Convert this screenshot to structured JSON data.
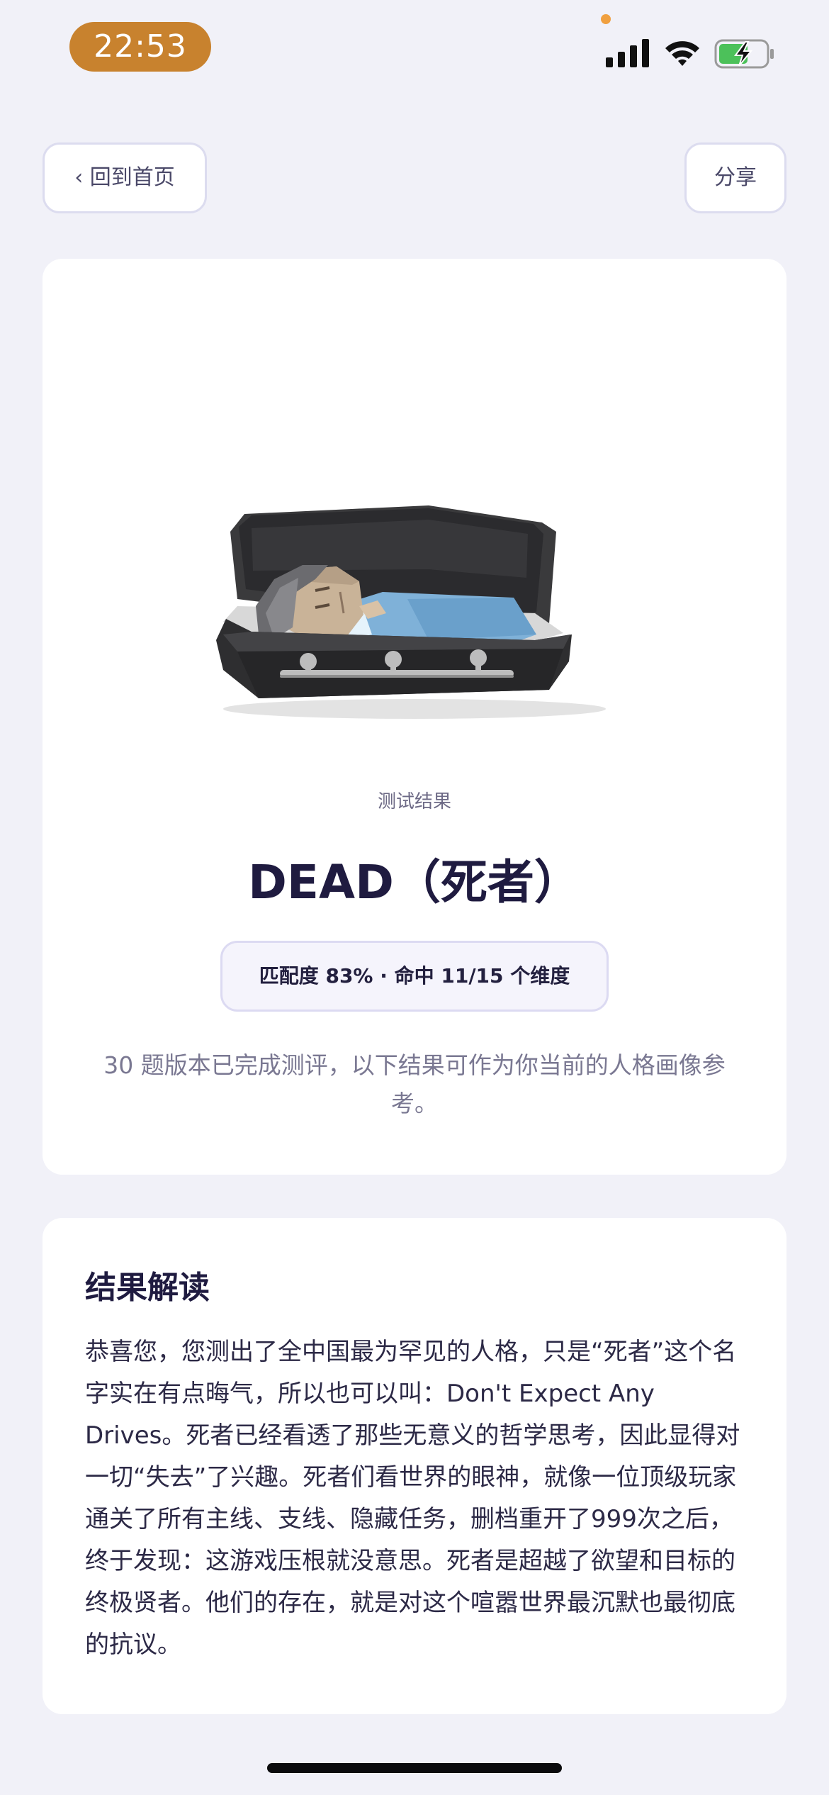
{
  "status_bar": {
    "time": "22:53"
  },
  "nav": {
    "back_label": "‹ 回到首页",
    "share_label": "分享"
  },
  "result": {
    "label": "测试结果",
    "title": "DEAD（死者）",
    "match": "匹配度 83% · 命中 11/15 个维度",
    "description": "30 题版本已完成测评，以下结果可作为你当前的人格画像参考。"
  },
  "interpretation": {
    "title": "结果解读",
    "body": "恭喜您，您测出了全中国最为罕见的人格，只是“死者”这个名字实在有点晦气，所以也可以叫：Don't Expect Any Drives。死者已经看透了那些无意义的哲学思考，因此显得对一切“失去”了兴趣。死者们看世界的眼神，就像一位顶级玩家通关了所有主线、支线、隐藏任务，删档重开了999次之后，终于发现：这游戏压根就没意思。死者是超越了欲望和目标的终极贤者。他们的存在，就是对这个喧嚣世界最沉默也最彻底的抗议。"
  },
  "colors": {
    "time_pill": "#c8822e",
    "background": "#f1f1f8",
    "card": "#ffffff",
    "title_text": "#1f1b40"
  },
  "icons": {
    "signal": "signal-icon",
    "wifi": "wifi-icon",
    "battery": "battery-charging-icon",
    "illustration": "coffin-illustration"
  }
}
